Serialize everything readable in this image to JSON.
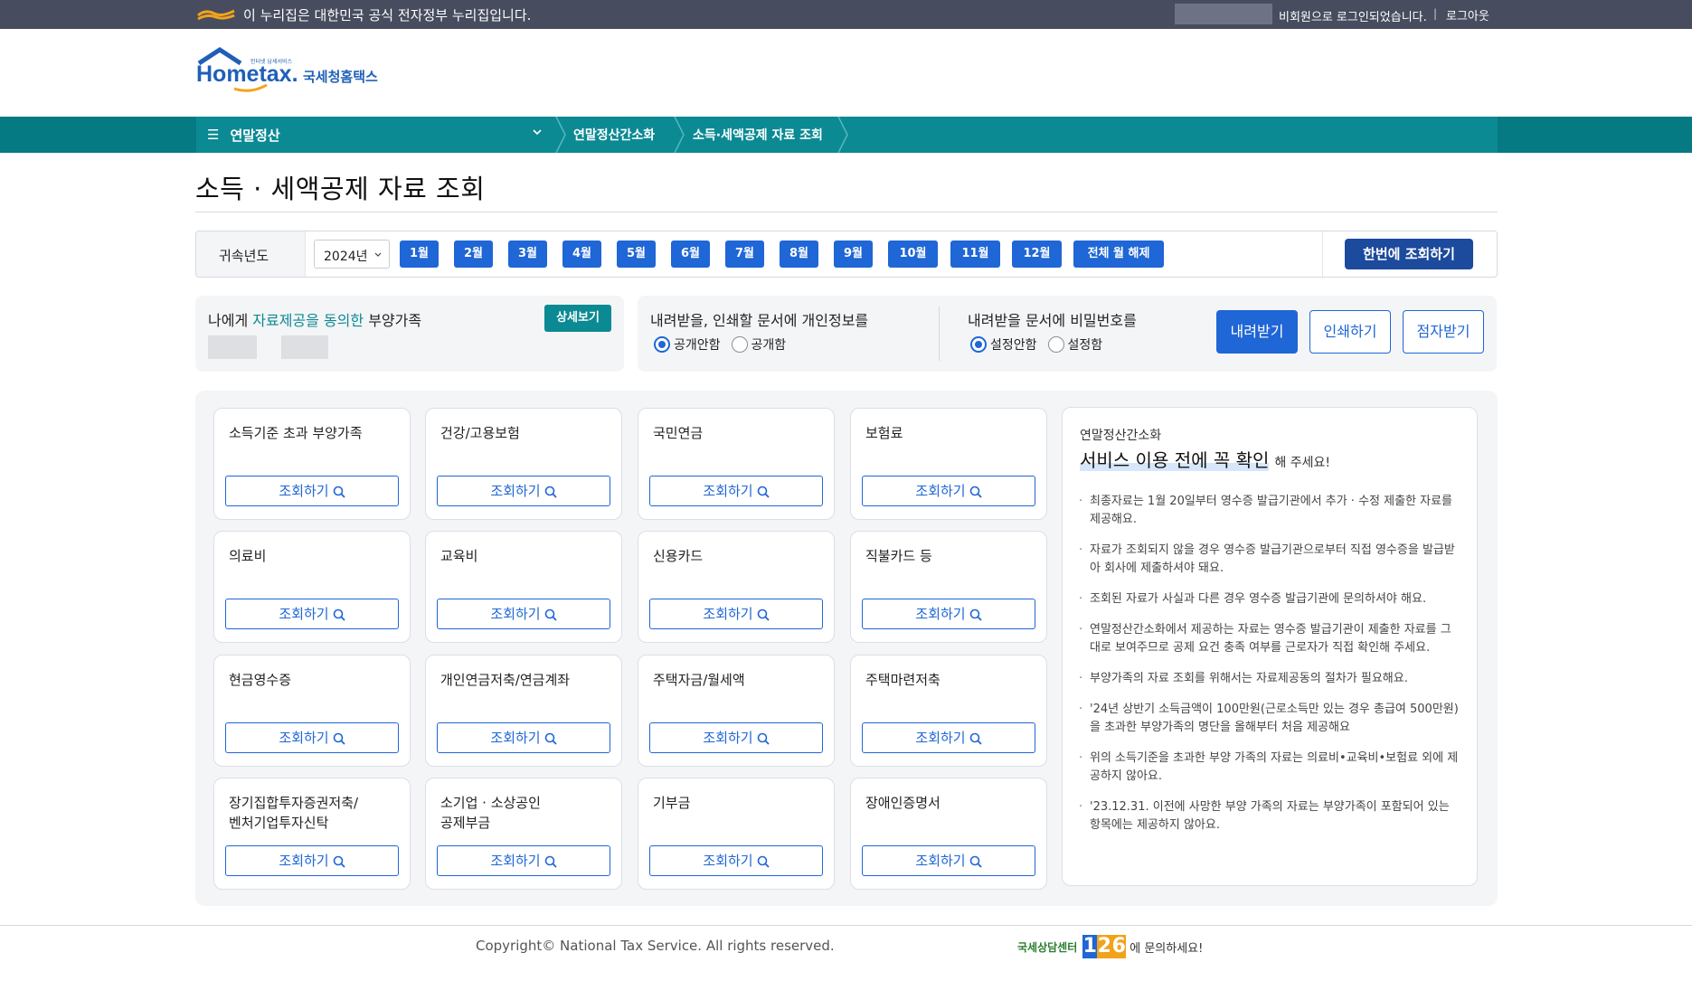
{
  "gov_banner": {
    "text": "이 누리집은 대한민국 공식 전자정부 누리집입니다.",
    "status": "비회원으로 로그인되었습니다.",
    "logout": "로그아웃"
  },
  "logo": {
    "en": "Hometax.",
    "ko": "국세청홈택스",
    "tagline": "인터넷 납세서비스"
  },
  "nav": {
    "menu_label": "연말정산",
    "crumbs": [
      "연말정산간소화",
      "소득·세액공제 자료 조회"
    ]
  },
  "page_title": "소득 · 세액공제 자료 조회",
  "filter": {
    "year_label": "귀속년도",
    "year_value": "2024년",
    "months": [
      "1월",
      "2월",
      "3월",
      "4월",
      "5월",
      "6월",
      "7월",
      "8월",
      "9월",
      "10월",
      "11월",
      "12월"
    ],
    "clear_all": "전체 월 해제",
    "query_all": "한번에 조회하기"
  },
  "consent": {
    "prefix": "나에게 ",
    "highlight1": "자료제공을",
    "space": " ",
    "highlight2": "동의한",
    "suffix": " 부양가족",
    "detail_button": "상세보기"
  },
  "options": {
    "privacy_title": "내려받을, 인쇄할 문서에 개인정보를",
    "privacy_opts": [
      "공개안함",
      "공개함"
    ],
    "password_title": "내려받을 문서에 비밀번호를",
    "password_opts": [
      "설정안함",
      "설정함"
    ],
    "download": "내려받기",
    "print": "인쇄하기",
    "braille": "점자받기"
  },
  "cards": [
    {
      "title": "소득기준 초과 부양가족",
      "button": "조회하기"
    },
    {
      "title": "건강/고용보험",
      "button": "조회하기"
    },
    {
      "title": "국민연금",
      "button": "조회하기"
    },
    {
      "title": "보험료",
      "button": "조회하기"
    },
    {
      "title": "의료비",
      "button": "조회하기"
    },
    {
      "title": "교육비",
      "button": "조회하기"
    },
    {
      "title": "신용카드",
      "button": "조회하기"
    },
    {
      "title": "직불카드 등",
      "button": "조회하기"
    },
    {
      "title": "현금영수증",
      "button": "조회하기"
    },
    {
      "title": "개인연금저축/연금계좌",
      "button": "조회하기"
    },
    {
      "title": "주택자금/월세액",
      "button": "조회하기"
    },
    {
      "title": "주택마련저축",
      "button": "조회하기"
    },
    {
      "title": "장기집합투자증권저축/\n벤처기업투자신탁",
      "button": "조회하기"
    },
    {
      "title": "소기업 · 소상공인\n공제부금",
      "button": "조회하기"
    },
    {
      "title": "기부금",
      "button": "조회하기"
    },
    {
      "title": "장애인증명서",
      "button": "조회하기"
    }
  ],
  "notice": {
    "subtitle": "연말정산간소화",
    "headline": "서비스 이용 전에 꼭 확인",
    "headline_suffix": "해 주세요!",
    "items": [
      "최종자료는 1월 20일부터 영수증 발급기관에서 추가 · 수정 제출한 자료를 제공해요.",
      "자료가 조회되지 않을 경우 영수증 발급기관으로부터 직접 영수증을 발급받아 회사에 제출하셔야 돼요.",
      "조회된 자료가 사실과 다른 경우 영수증 발급기관에 문의하셔야 해요.",
      "연말정산간소화에서 제공하는 자료는 영수증 발급기관이 제출한 자료를 그대로 보여주므로 공제 요건 충족 여부를 근로자가 직접 확인해 주세요.",
      "부양가족의 자료 조회를 위해서는 자료제공동의 절차가 필요해요.",
      "'24년 상반기 소득금액이 100만원(근로소득만 있는 경우 총급여 500만원)을 초과한 부양가족의 명단을 올해부터 처음 제공해요",
      "위의 소득기준을 초과한 부양 가족의 자료는 의료비•교육비•보험료 외에 제공하지 않아요.",
      "'23.12.31. 이전에 사망한 부양 가족의 자료는 부양가족이 포함되어 있는 항목에는 제공하지 않아요."
    ]
  },
  "footer": {
    "copyright": "Copyright© National Tax Service. All rights reserved.",
    "call_brand": "국세상담센터",
    "call_digits": [
      "1",
      "2",
      "6"
    ],
    "call_suffix": "에 문의하세요!"
  },
  "colors": {
    "gov_bar": "#474c5e",
    "nav_bar": "#0b8a93",
    "primary_blue": "#1f66d6",
    "dark_blue": "#1c4a9c",
    "teal": "#0b8a93"
  }
}
